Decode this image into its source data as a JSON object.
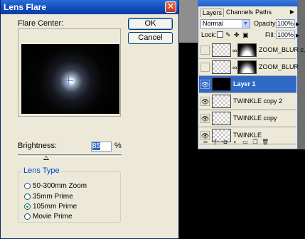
{
  "dialog": {
    "title": "Lens Flare",
    "close_glyph": "✕",
    "flare_center_label": "Flare Center:",
    "ok_label": "OK",
    "cancel_label": "Cancel",
    "brightness_label": "Brightness:",
    "brightness_value": "85",
    "brightness_unit": "%",
    "lens_type_title": "Lens Type",
    "lens_options": [
      {
        "label": "50-300mm Zoom",
        "selected": false
      },
      {
        "label": "35mm Prime",
        "selected": false
      },
      {
        "label": "105mm Prime",
        "selected": true
      },
      {
        "label": "Movie Prime",
        "selected": false
      }
    ]
  },
  "layers_panel": {
    "tabs": [
      "Layers",
      "Channels",
      "Paths"
    ],
    "active_tab": "Layers",
    "blend_mode": "Normal",
    "opacity_label": "Opacity:",
    "opacity_value": "100%",
    "lock_label": "Lock:",
    "fill_label": "Fill:",
    "fill_value": "100%",
    "layers": [
      {
        "name": "ZOOM_BLUR c...",
        "visible": false,
        "has_mask": true,
        "selected": false
      },
      {
        "name": "ZOOM_BLUR",
        "visible": false,
        "has_mask": true,
        "selected": false
      },
      {
        "name": "Layer 1",
        "visible": true,
        "has_mask": false,
        "selected": true
      },
      {
        "name": "TWINKLE copy 2",
        "visible": true,
        "has_mask": false,
        "selected": false
      },
      {
        "name": "TWINKLE copy",
        "visible": true,
        "has_mask": false,
        "selected": false
      },
      {
        "name": "TWINKLE",
        "visible": true,
        "has_mask": false,
        "selected": false
      }
    ]
  },
  "icons": {
    "eye": "eye-icon",
    "chain": "link-icon",
    "panel_menu": "panel-menu-icon"
  }
}
